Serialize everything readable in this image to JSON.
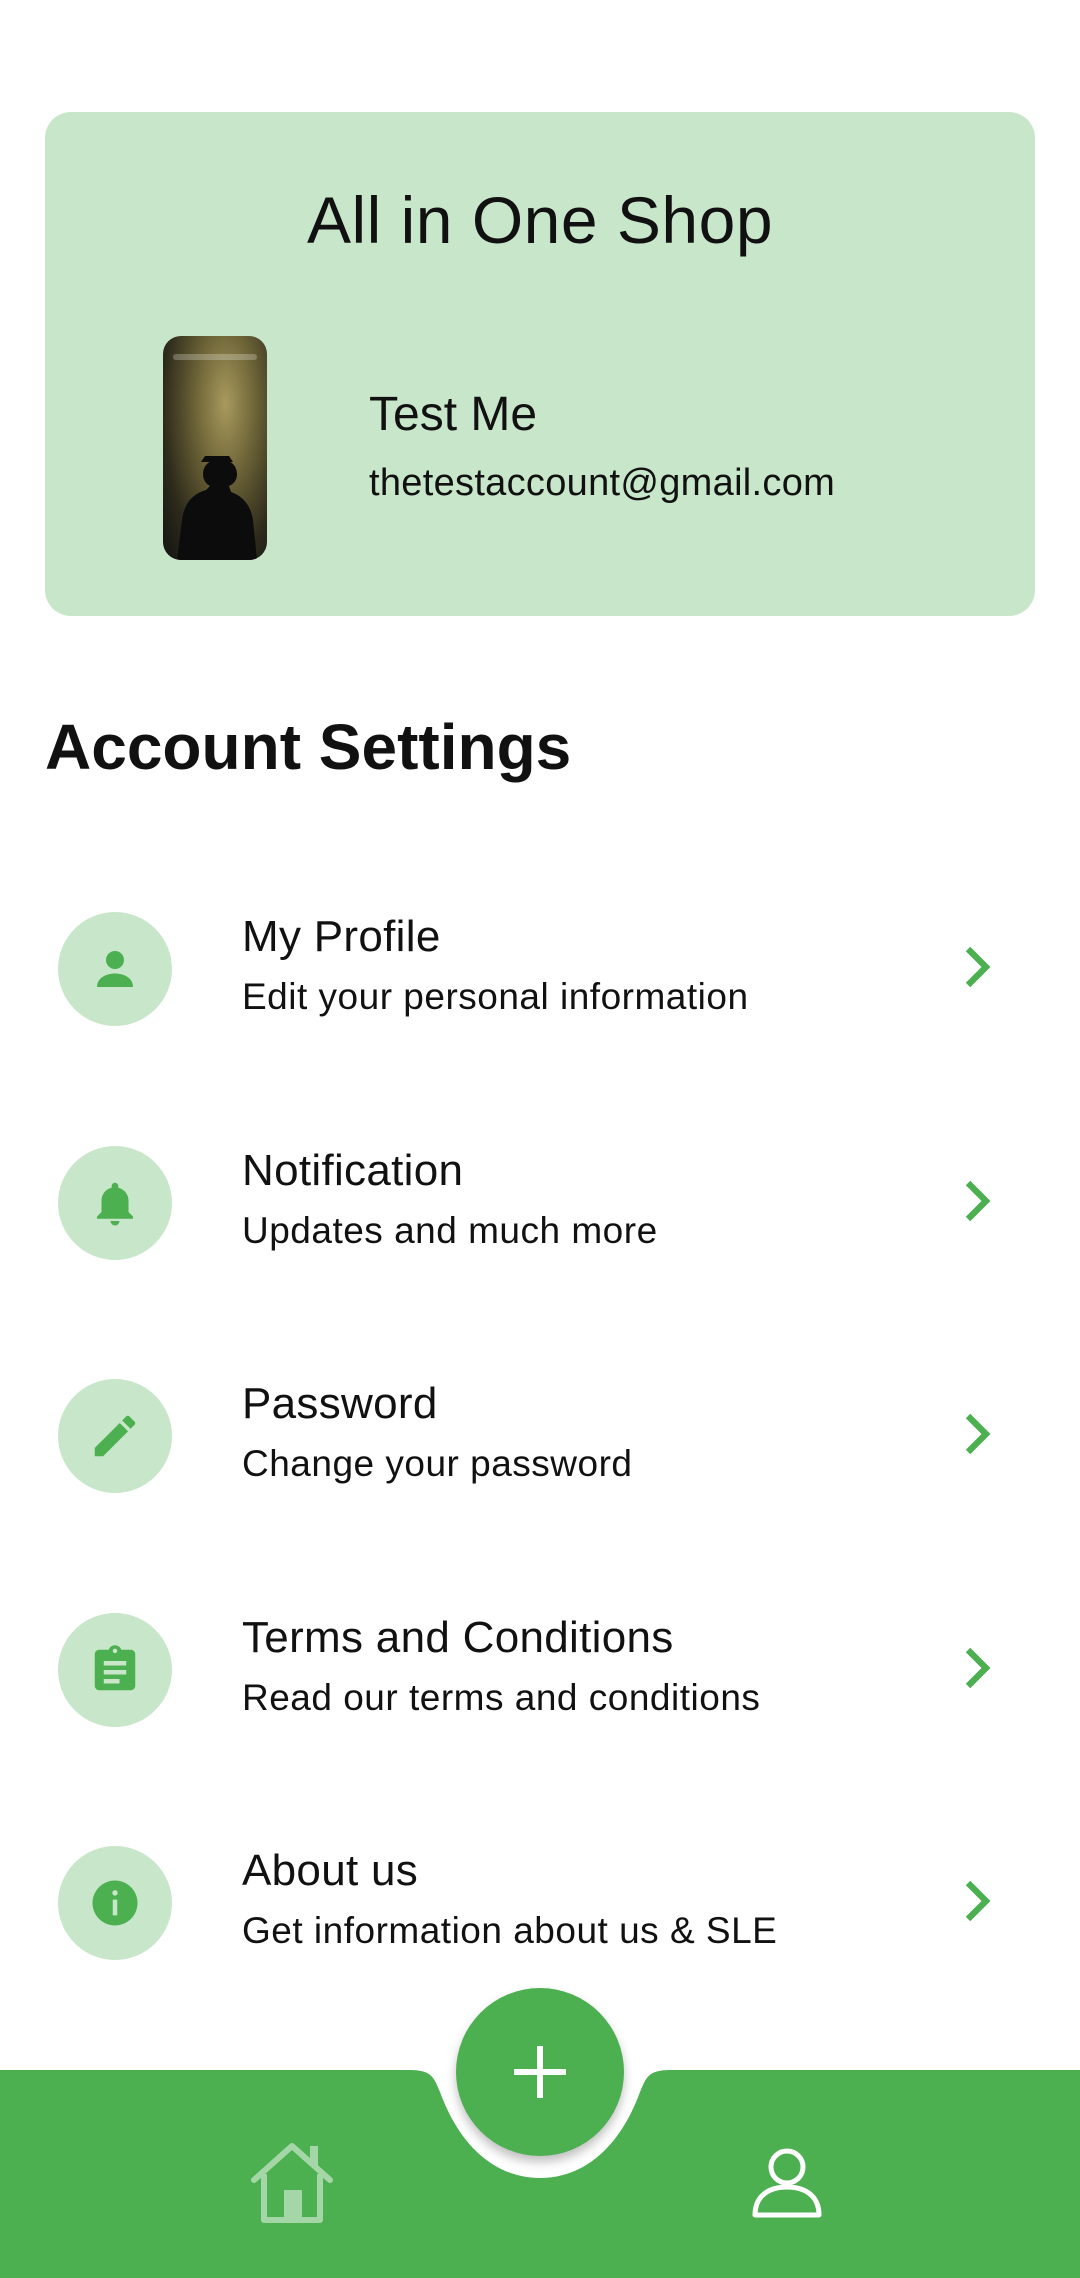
{
  "header": {
    "shop_title": "All in One Shop",
    "user_name": "Test Me",
    "user_email": "thetestaccount@gmail.com"
  },
  "section_title": "Account Settings",
  "settings": [
    {
      "title": "My Profile",
      "subtitle": "Edit your personal information",
      "icon": "person-icon"
    },
    {
      "title": "Notification",
      "subtitle": "Updates and much more",
      "icon": "bell-icon"
    },
    {
      "title": "Password",
      "subtitle": "Change your password",
      "icon": "pencil-icon"
    },
    {
      "title": "Terms and Conditions",
      "subtitle": "Read our terms and conditions",
      "icon": "clipboard-icon"
    },
    {
      "title": "About us",
      "subtitle": "Get information about us & SLE",
      "icon": "info-icon"
    }
  ],
  "bottom_nav": {
    "items": [
      "home-icon",
      "add-icon",
      "profile-icon"
    ]
  },
  "colors": {
    "accent": "#4caf50",
    "accent_light": "#c8e6c9",
    "nav_icon_home": "#a5d6a7",
    "nav_icon_profile": "#ffffff"
  }
}
